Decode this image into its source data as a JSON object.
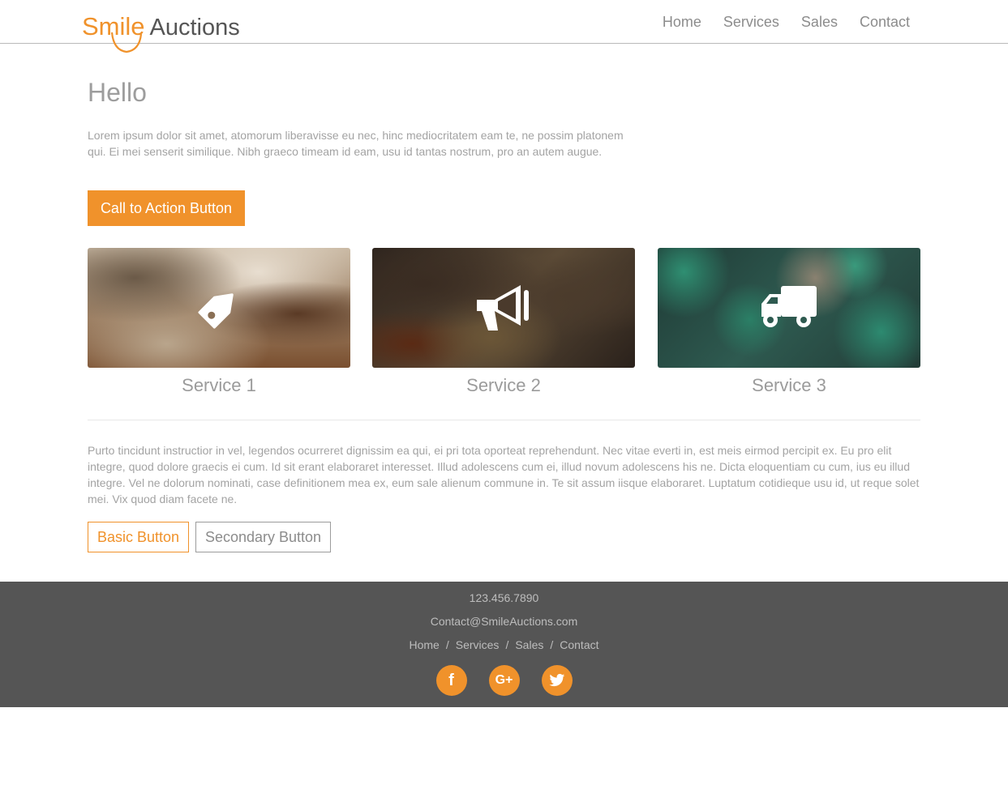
{
  "brand": {
    "logo_first": "Smile",
    "logo_second": "Auctions",
    "accent_color": "#f0922b"
  },
  "nav": {
    "items": [
      {
        "label": "Home"
      },
      {
        "label": "Services"
      },
      {
        "label": "Sales"
      },
      {
        "label": "Contact"
      }
    ]
  },
  "hero": {
    "heading": "Hello",
    "paragraph": "Lorem ipsum dolor sit amet, atomorum liberavisse eu nec, hinc mediocritatem eam te, ne possim platonem qui. Ei mei senserit similique. Nibh graeco timeam id eam, usu id tantas nostrum, pro an autem augue.",
    "cta_label": "Call to Action Button"
  },
  "services": [
    {
      "title": "Service 1",
      "icon": "tag-icon"
    },
    {
      "title": "Service 2",
      "icon": "megaphone-icon"
    },
    {
      "title": "Service 3",
      "icon": "truck-icon"
    }
  ],
  "content": {
    "paragraph": "Purto tincidunt instructior in vel, legendos ocurreret dignissim ea qui, ei pri tota oporteat reprehendunt. Nec vitae everti in, est meis eirmod percipit ex. Eu pro elit integre, quod dolore graecis ei cum. Id sit erant elaboraret interesset. Illud adolescens cum ei, illud novum adolescens his ne. Dicta eloquentiam cu cum, ius eu illud integre. Vel ne dolorum nominati, case definitionem mea ex, eum sale alienum commune in. Te sit assum iisque elaboraret. Luptatum cotidieque usu id, ut reque solet mei. Vix quod diam facete ne.",
    "basic_button": "Basic Button",
    "secondary_button": "Secondary Button"
  },
  "footer": {
    "phone": "123.456.7890",
    "email": "Contact@SmileAuctions.com",
    "links": [
      {
        "label": "Home"
      },
      {
        "label": "Services"
      },
      {
        "label": "Sales"
      },
      {
        "label": "Contact"
      }
    ],
    "separator": "/",
    "social": [
      {
        "label": "f",
        "icon": "facebook-icon"
      },
      {
        "label": "G+",
        "icon": "google-plus-icon"
      },
      {
        "icon": "twitter-icon"
      }
    ]
  }
}
